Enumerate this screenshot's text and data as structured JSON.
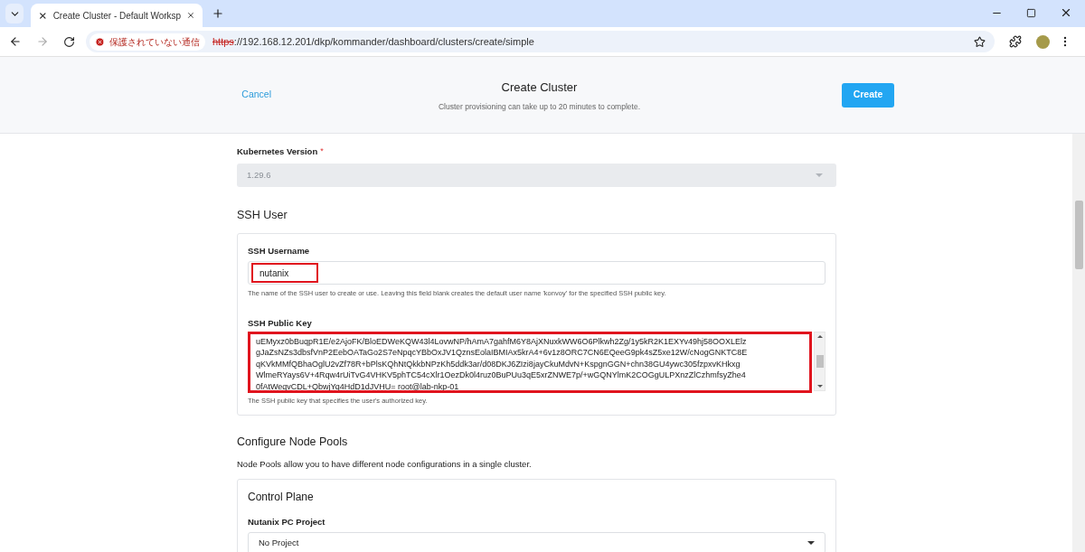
{
  "browser": {
    "tab": {
      "title": "Create Cluster - Default Worksp",
      "selected": true
    },
    "security": "保護されていない通信",
    "url_scheme": "https",
    "url_rest": "://192.168.12.201/dkp/kommander/dashboard/clusters/create/simple"
  },
  "header": {
    "cancel": "Cancel",
    "title": "Create Cluster",
    "subtitle": "Cluster provisioning can take up to 20 minutes to complete.",
    "create": "Create"
  },
  "kubernetes_version": {
    "label": "Kubernetes Version",
    "required_mark": "*",
    "value": "1.29.6",
    "disabled": true
  },
  "ssh_user": {
    "heading": "SSH User",
    "username": {
      "label": "SSH Username",
      "value": "nutanix",
      "highlighted": true,
      "help": "The name of the SSH user to create or use. Leaving this field blank creates the default user name 'konvoy' for the specified SSH public key."
    },
    "public_key": {
      "label": "SSH Public Key",
      "highlighted": true,
      "lines": [
        "uEMyxz0bBuqpR1E/e2AjoFK/BloEDWeKQW43l4LovwNP/hAmA7gahfM6Y8AjXNuxkWW6O6Plkwh2Zg/1y5kR2K1EXYv49hj58OOXLElz",
        "gJaZsNZs3dbsfVnP2EebOATaGo2S7eNpqcYBbOxJV1QznsEolaIBMIAx5krA4+6v1z8ORC7CN6EQeeG9pk4sZ5xe12W/cNogGNKTC8E",
        "qKVkMMfQBhaOglU2vZf78R+bPlsKQhNtQkkbNPzKh5ddk3ar/d08DKJ6ZIzi8jayCkuMdvN+KspgnGGN+chn38GU4ywc305fzpxvKHkxg",
        "WlmeRYays6V+4Rqw4rUiTvG4VHKV5phTC54cXlr1OezDk0l4ruz0BuPUu3qE5xrZNWE7p/+wGQNYlmK2COGgULPXnzZlCzhmfsyZhe4",
        "0fAtWeqvCDL+QbwjYq4HdD1dJVHU= root@lab-nkp-01"
      ],
      "help": "The SSH public key that specifies the user's authorized key."
    }
  },
  "node_pools": {
    "heading": "Configure Node Pools",
    "description": "Node Pools allow you to have different node configurations in a single cluster.",
    "control_plane": {
      "heading": "Control Plane",
      "project_label": "Nutanix PC Project",
      "project_value": "No Project"
    }
  }
}
